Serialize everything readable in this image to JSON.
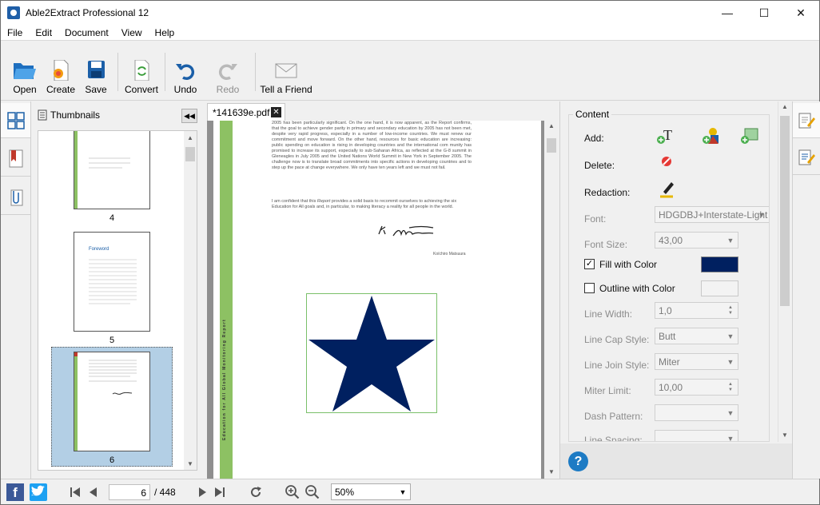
{
  "window": {
    "title": "Able2Extract Professional 12",
    "minimize": "—",
    "maximize": "☐",
    "close": "✕"
  },
  "menu": [
    "File",
    "Edit",
    "Document",
    "View",
    "Help"
  ],
  "toolbar": {
    "open": "Open",
    "create": "Create",
    "save": "Save",
    "convert": "Convert",
    "undo": "Undo",
    "redo": "Redo",
    "tell_a_friend": "Tell a Friend"
  },
  "thumbnails": {
    "header": "Thumbnails",
    "pages": [
      {
        "num": "4",
        "label": ""
      },
      {
        "num": "5",
        "label": "Foreword"
      },
      {
        "num": "6",
        "label": ""
      }
    ]
  },
  "document": {
    "tab": "*141639e.pdf",
    "sidebar_text": "Education for All Global Monitoring Report",
    "body": "2005 has been particularly significant. On the one hand, it is now apparent, as the Report confirms, that the goal to achieve gender parity in primary and secondary education by 2005 has not been met, despite very rapid progress, especially in a number of low-income countries. We must renew our commitment and move forward. On the other hand, resources for basic education are increasing: public spending on education is rising in developing countries and the international com munity has promised to increase its support, especially to sub-Saharan Africa, as reflected at the G-8 summit in Gleneagles in July 2005 and the United Nations World Summit in New York in September 2005. The challenge now is to translate broad commitments into specific actions in developing countries and to step up the pace at change everywhere. We only have ten years left and we must not fail.",
    "body2_pre": "I am confident that this ",
    "body2_em": "Report",
    "body2_post": " provides a solid basis to recommit ourselves to achieving the six Education for All goals and, in particular, to making literacy a reality for all people in the world.",
    "signature": "K. Matsuura",
    "signatory": "Koïchiro Matsuura",
    "star_color": "#002060"
  },
  "content_panel": {
    "title": "Content",
    "add_label": "Add:",
    "delete_label": "Delete:",
    "redaction_label": "Redaction:",
    "font_label": "Font:",
    "font_value": "HDGDBJ+Interstate-Light",
    "font_size_label": "Font Size:",
    "font_size_value": "43,00",
    "fill_label": "Fill with Color",
    "fill_checked": "✓",
    "fill_color": "#002060",
    "outline_label": "Outline with Color",
    "line_width_label": "Line Width:",
    "line_width_value": "1,0",
    "line_cap_label": "Line Cap Style:",
    "line_cap_value": "Butt",
    "line_join_label": "Line Join Style:",
    "line_join_value": "Miter",
    "miter_label": "Miter Limit:",
    "miter_value": "10,00",
    "dash_label": "Dash Pattern:",
    "line_spacing_label": "Line Spacing:"
  },
  "statusbar": {
    "current_page": "6",
    "total_pages": "/ 448",
    "zoom": "50%",
    "facebook": "f"
  },
  "colors": {
    "accent": "#1f5fa8",
    "selection": "#b3cfe5",
    "green_bar": "#8dc163"
  }
}
